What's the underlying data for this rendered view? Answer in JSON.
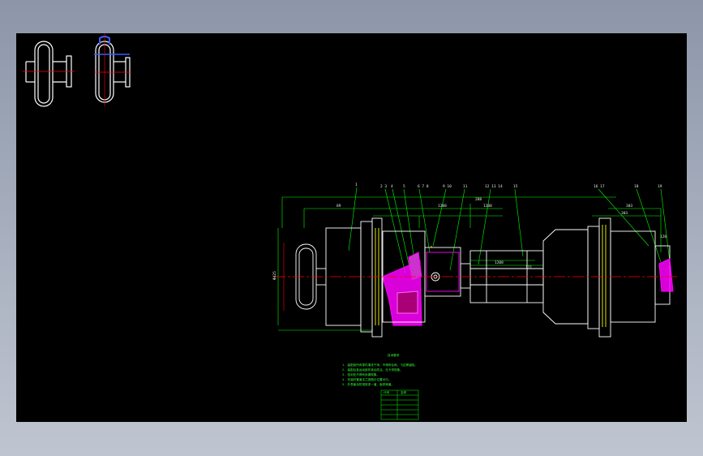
{
  "drawing": {
    "background_color": "#000000",
    "outline_color": "#ffffff",
    "dimension_color": "#00ff00",
    "centerline_color": "#ff0000",
    "section_color": "#ff00ff",
    "flange_color": "#ffff00",
    "detail_color": "#0000ff"
  },
  "part_labels": [
    "1",
    "2 3",
    "4",
    "5",
    "6 7 8",
    "9 10",
    "11",
    "12 13 14",
    "15",
    "16 17",
    "18",
    "19"
  ],
  "dimension_labels": {
    "overall": "288",
    "left_flange": "89",
    "mid_1": "1208",
    "mid_2": "1208",
    "right_1": "303",
    "right_2": "303",
    "segment_a": "1208",
    "segment_b": "121",
    "segment_c": "120",
    "diameter": "Φ425"
  },
  "notes": {
    "heading": "技术要求",
    "lines": [
      "1. 装配前所有零件清洗干净，不得有毛刺、飞边等缺陷。",
      "2. 装配后各运动部件转动灵活，无卡滞现象。",
      "3. 密封处不得有渗漏现象。",
      "4. 安装时管道法兰按图示位置对中。",
      "5. 外表面涂防锈底漆一道，面漆两道。"
    ]
  },
  "table": {
    "headers": [
      "代号",
      "名称"
    ],
    "rows": [
      [
        "",
        ""
      ],
      [
        "",
        ""
      ],
      [
        "",
        ""
      ],
      [
        "",
        ""
      ],
      [
        "",
        ""
      ]
    ]
  }
}
